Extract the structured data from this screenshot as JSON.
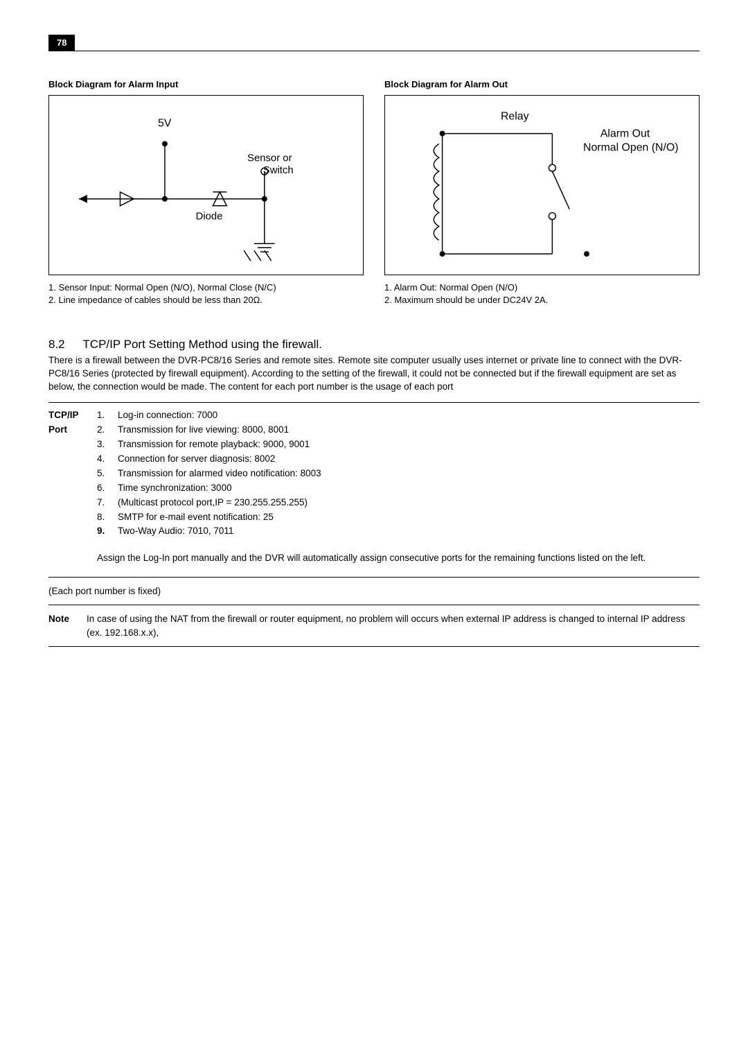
{
  "page_number": "78",
  "left": {
    "title": "Block Diagram for Alarm Input",
    "labels": {
      "v": "5V",
      "sensor": "Sensor or",
      "switch": "Switch",
      "diode": "Diode"
    },
    "captions": [
      "1. Sensor Input: Normal Open (N/O), Normal Close (N/C)",
      "2. Line impedance of cables should be less than 20Ω."
    ]
  },
  "right": {
    "title": "Block Diagram for Alarm Out",
    "labels": {
      "relay": "Relay",
      "alarmout": "Alarm Out",
      "normal": "Normal Open (N/O)"
    },
    "captions": [
      "1. Alarm Out: Normal Open (N/O)",
      "2. Maximum should be under DC24V 2A."
    ]
  },
  "section": {
    "num": "8.2",
    "title": "TCP/IP Port Setting Method using the firewall."
  },
  "intro": "There is a firewall between the DVR-PC8/16 Series and remote sites. Remote site computer usually uses internet or private line to connect with the DVR-PC8/16 Series (protected by firewall equipment). According to the setting of the firewall, it could not be connected but if the firewall equipment are set as below, the connection would be made. The content for each port number is the usage of each port",
  "port_label1": "TCP/IP",
  "port_label2": "Port",
  "ports": [
    {
      "n": "1.",
      "t": "Log-in connection: 7000",
      "bold": false
    },
    {
      "n": "2.",
      "t": "Transmission for live viewing: 8000, 8001",
      "bold": false
    },
    {
      "n": "3.",
      "t": "Transmission for remote playback: 9000, 9001",
      "bold": false
    },
    {
      "n": "4.",
      "t": "Connection for server diagnosis: 8002",
      "bold": false
    },
    {
      "n": "5.",
      "t": "Transmission for alarmed video notification: 8003",
      "bold": false
    },
    {
      "n": "6.",
      "t": "Time synchronization: 3000",
      "bold": false
    },
    {
      "n": "7.",
      "t": "(Multicast protocol port,IP = 230.255.255.255)",
      "bold": false
    },
    {
      "n": "8.",
      "t": "SMTP for e-mail event notification: 25",
      "bold": false
    },
    {
      "n": "9.",
      "t": "Two-Way Audio: 7010, 7011",
      "bold": true
    }
  ],
  "assign": "Assign the Log-In port manually and the DVR will automatically assign consecutive ports for the remaining functions listed on the left.",
  "fixed": "(Each port number is fixed)",
  "note_label": "Note",
  "note_text": "In case of using the NAT from the firewall or router equipment, no problem will occurs when external IP address is changed to internal IP address (ex. 192.168.x.x),"
}
